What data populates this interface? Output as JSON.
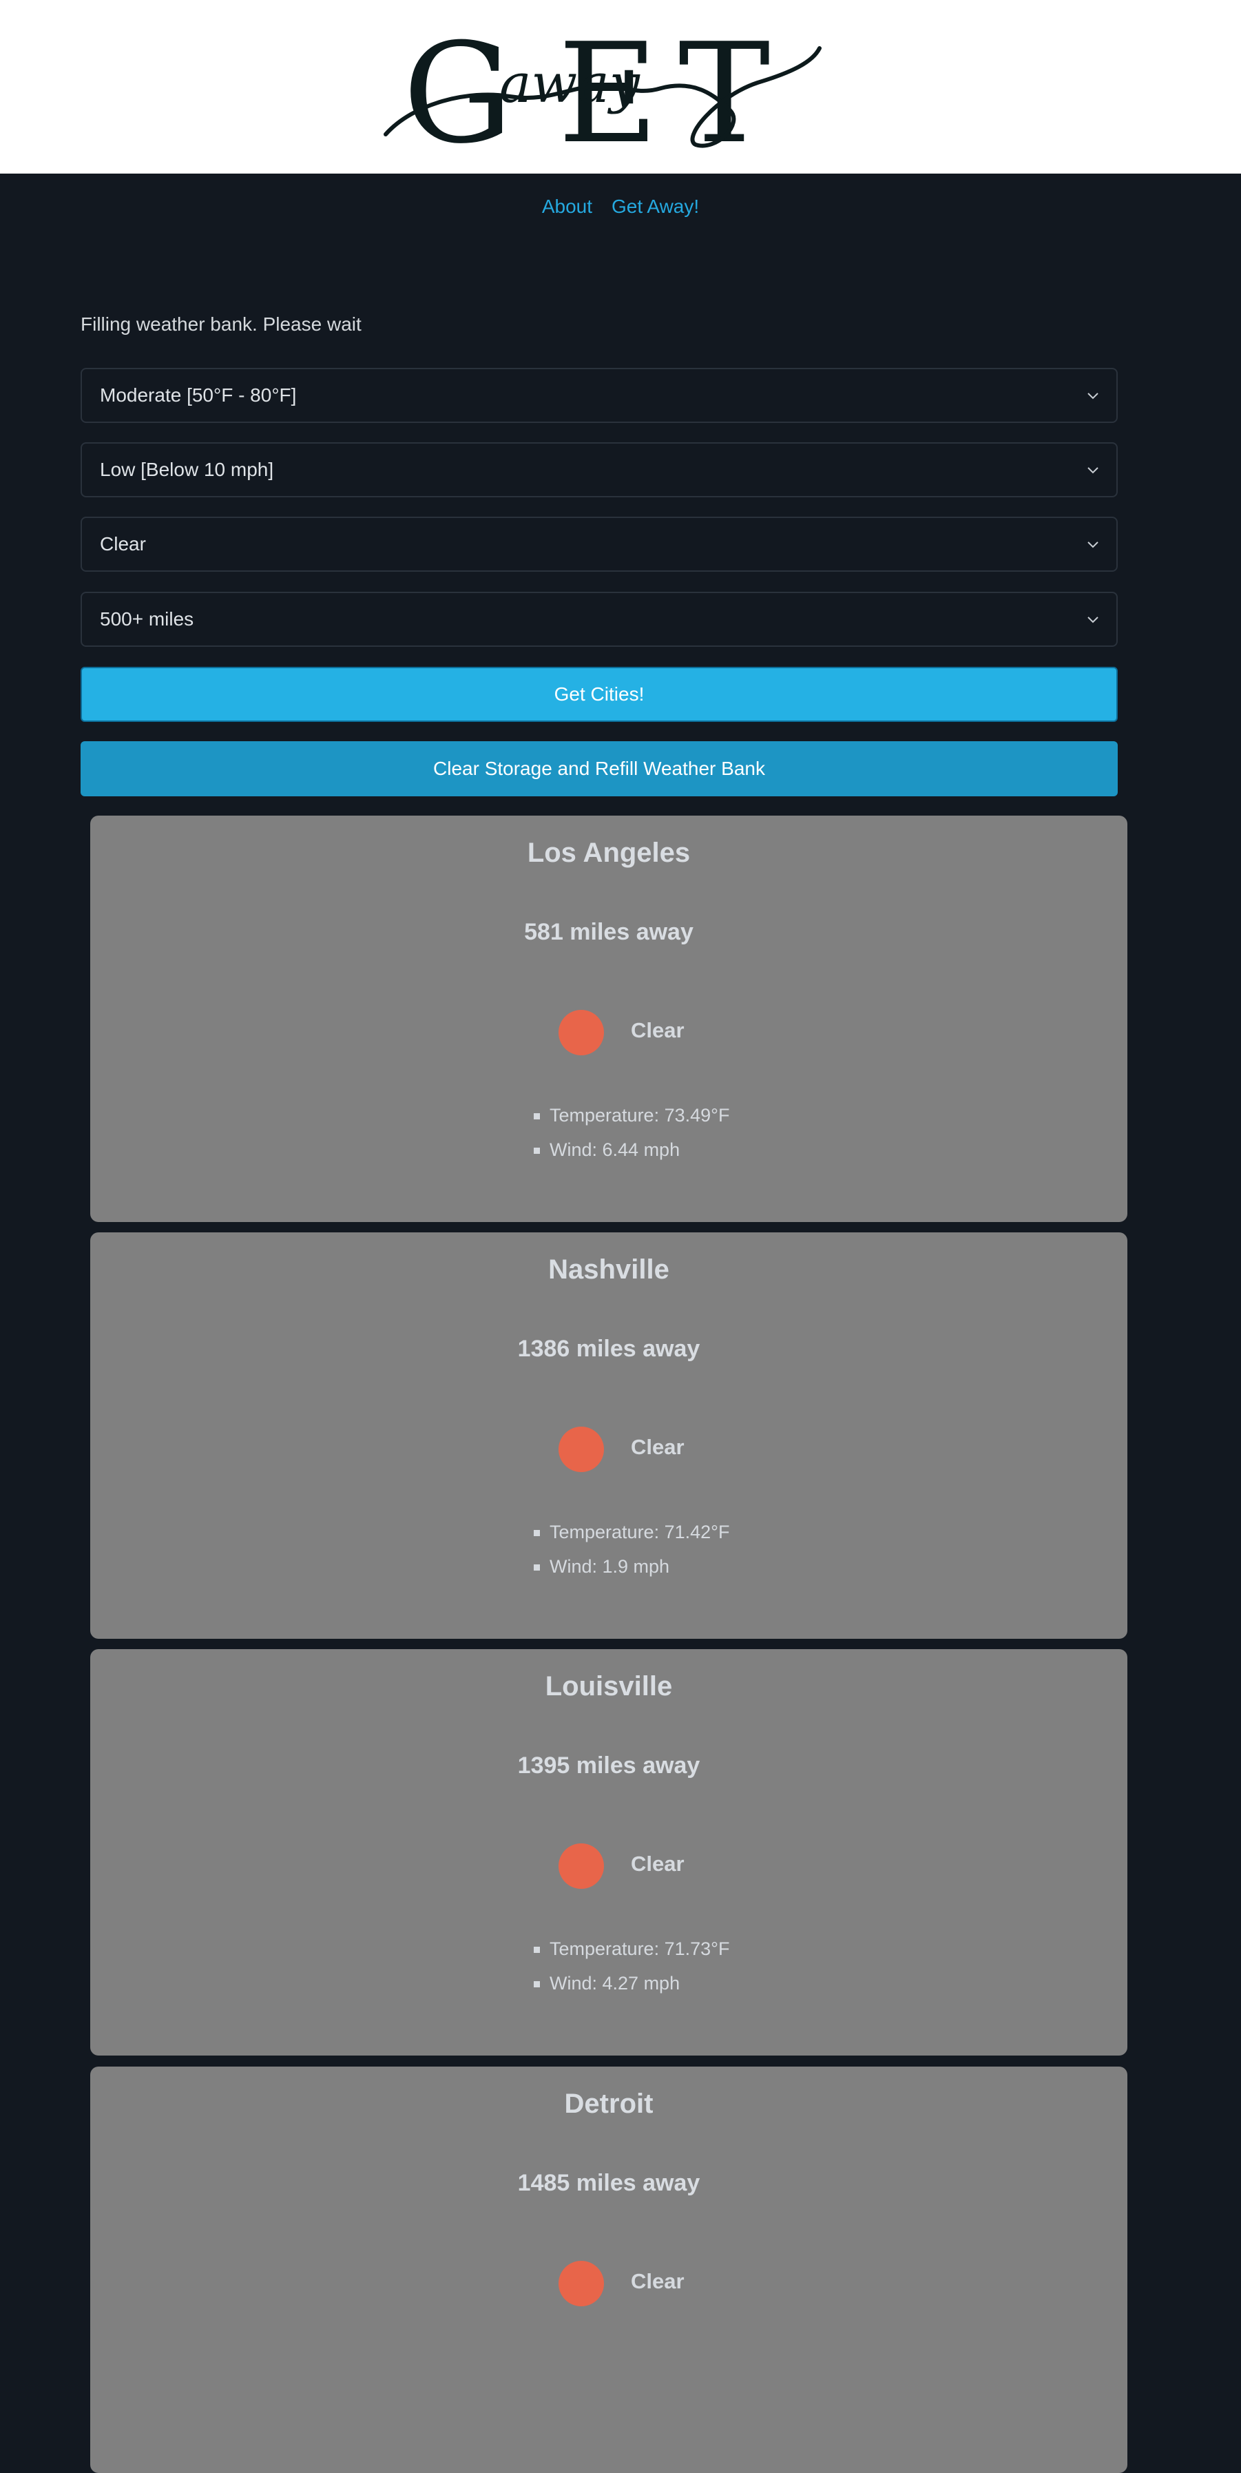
{
  "header": {
    "logo_alt": "GEtAway (GET Away logo)",
    "logo_letters": [
      "G",
      "E",
      "T"
    ],
    "logo_script": "away"
  },
  "nav": {
    "about": "About",
    "getaway": "Get Away!"
  },
  "status_text": "Filling weather bank. Please wait",
  "filters": {
    "temperature": "Moderate [50°F - 80°F]",
    "wind": "Low [Below 10 mph]",
    "condition": "Clear",
    "distance": "500+ miles"
  },
  "buttons": {
    "get_cities": "Get Cities!",
    "refill": "Clear Storage and Refill Weather Bank"
  },
  "colors": {
    "page_bg": "#121820",
    "link": "#25a9e0",
    "primary_button": "#25b1e4",
    "secondary_button": "#1d95c4",
    "card_bg": "#808080",
    "sun_icon": "#e8654a"
  },
  "cities": [
    {
      "name": "Los Angeles",
      "distance": "581 miles away",
      "condition": "Clear",
      "icon": "sun-icon",
      "temperature": "Temperature: 73.49°F",
      "wind": "Wind: 6.44 mph"
    },
    {
      "name": "Nashville",
      "distance": "1386 miles away",
      "condition": "Clear",
      "icon": "sun-icon",
      "temperature": "Temperature: 71.42°F",
      "wind": "Wind: 1.9 mph"
    },
    {
      "name": "Louisville",
      "distance": "1395 miles away",
      "condition": "Clear",
      "icon": "sun-icon",
      "temperature": "Temperature: 71.73°F",
      "wind": "Wind: 4.27 mph"
    },
    {
      "name": "Detroit",
      "distance": "1485 miles away",
      "condition": "Clear",
      "icon": "sun-icon"
    }
  ]
}
